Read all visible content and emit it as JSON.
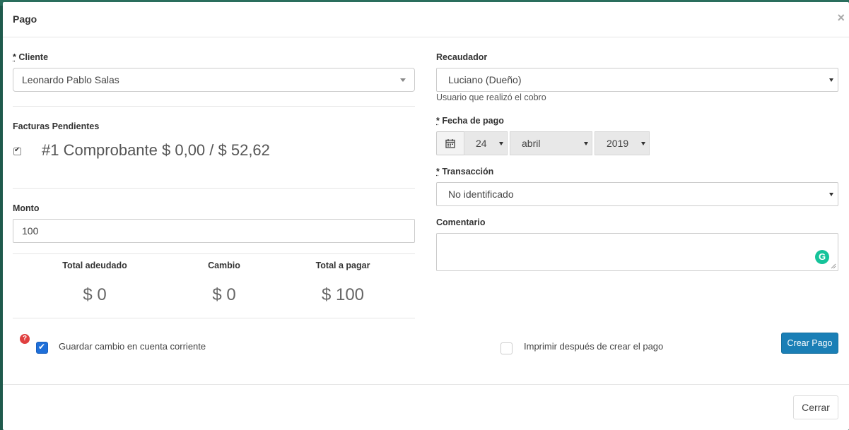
{
  "modal": {
    "title": "Pago",
    "close_symbol": "×"
  },
  "left": {
    "cliente": {
      "label_req": "*",
      "label": " Cliente",
      "value": "Leonardo Pablo Salas"
    },
    "facturas": {
      "label": "Facturas Pendientes",
      "items": [
        {
          "text": "#1 Comprobante $ 0,00 / $ 52,62",
          "checked": true
        }
      ]
    },
    "monto": {
      "label": "Monto",
      "value": "100"
    },
    "stats": [
      {
        "label": "Total adeudado",
        "value": "$ 0"
      },
      {
        "label": "Cambio",
        "value": "$ 0"
      },
      {
        "label": "Total a pagar",
        "value": "$ 100"
      }
    ],
    "help_symbol": "?",
    "guardar_cambio": {
      "label": "Guardar cambio en cuenta corriente",
      "checked": true
    }
  },
  "right": {
    "recaudador": {
      "label": "Recaudador",
      "value": "Luciano (Dueño)",
      "hint": "Usuario que realizó el cobro"
    },
    "fecha": {
      "label_req": "*",
      "label": " Fecha de pago",
      "day": "24",
      "month": "abril",
      "year": "2019"
    },
    "transaccion": {
      "label_req": "*",
      "label": " Transacción",
      "value": "No identificado"
    },
    "comentario": {
      "label": "Comentario",
      "value": "",
      "grammarly_letter": "G"
    },
    "imprimir": {
      "label": "Imprimir después de crear el pago",
      "checked": false
    },
    "crear_pago_label": "Crear Pago"
  },
  "footer": {
    "cerrar_label": "Cerrar"
  },
  "colors": {
    "primary": "#1a7fb6",
    "checkbox_blue": "#1e6fd9",
    "help_red": "#e04040",
    "grammarly": "#15c39a"
  }
}
